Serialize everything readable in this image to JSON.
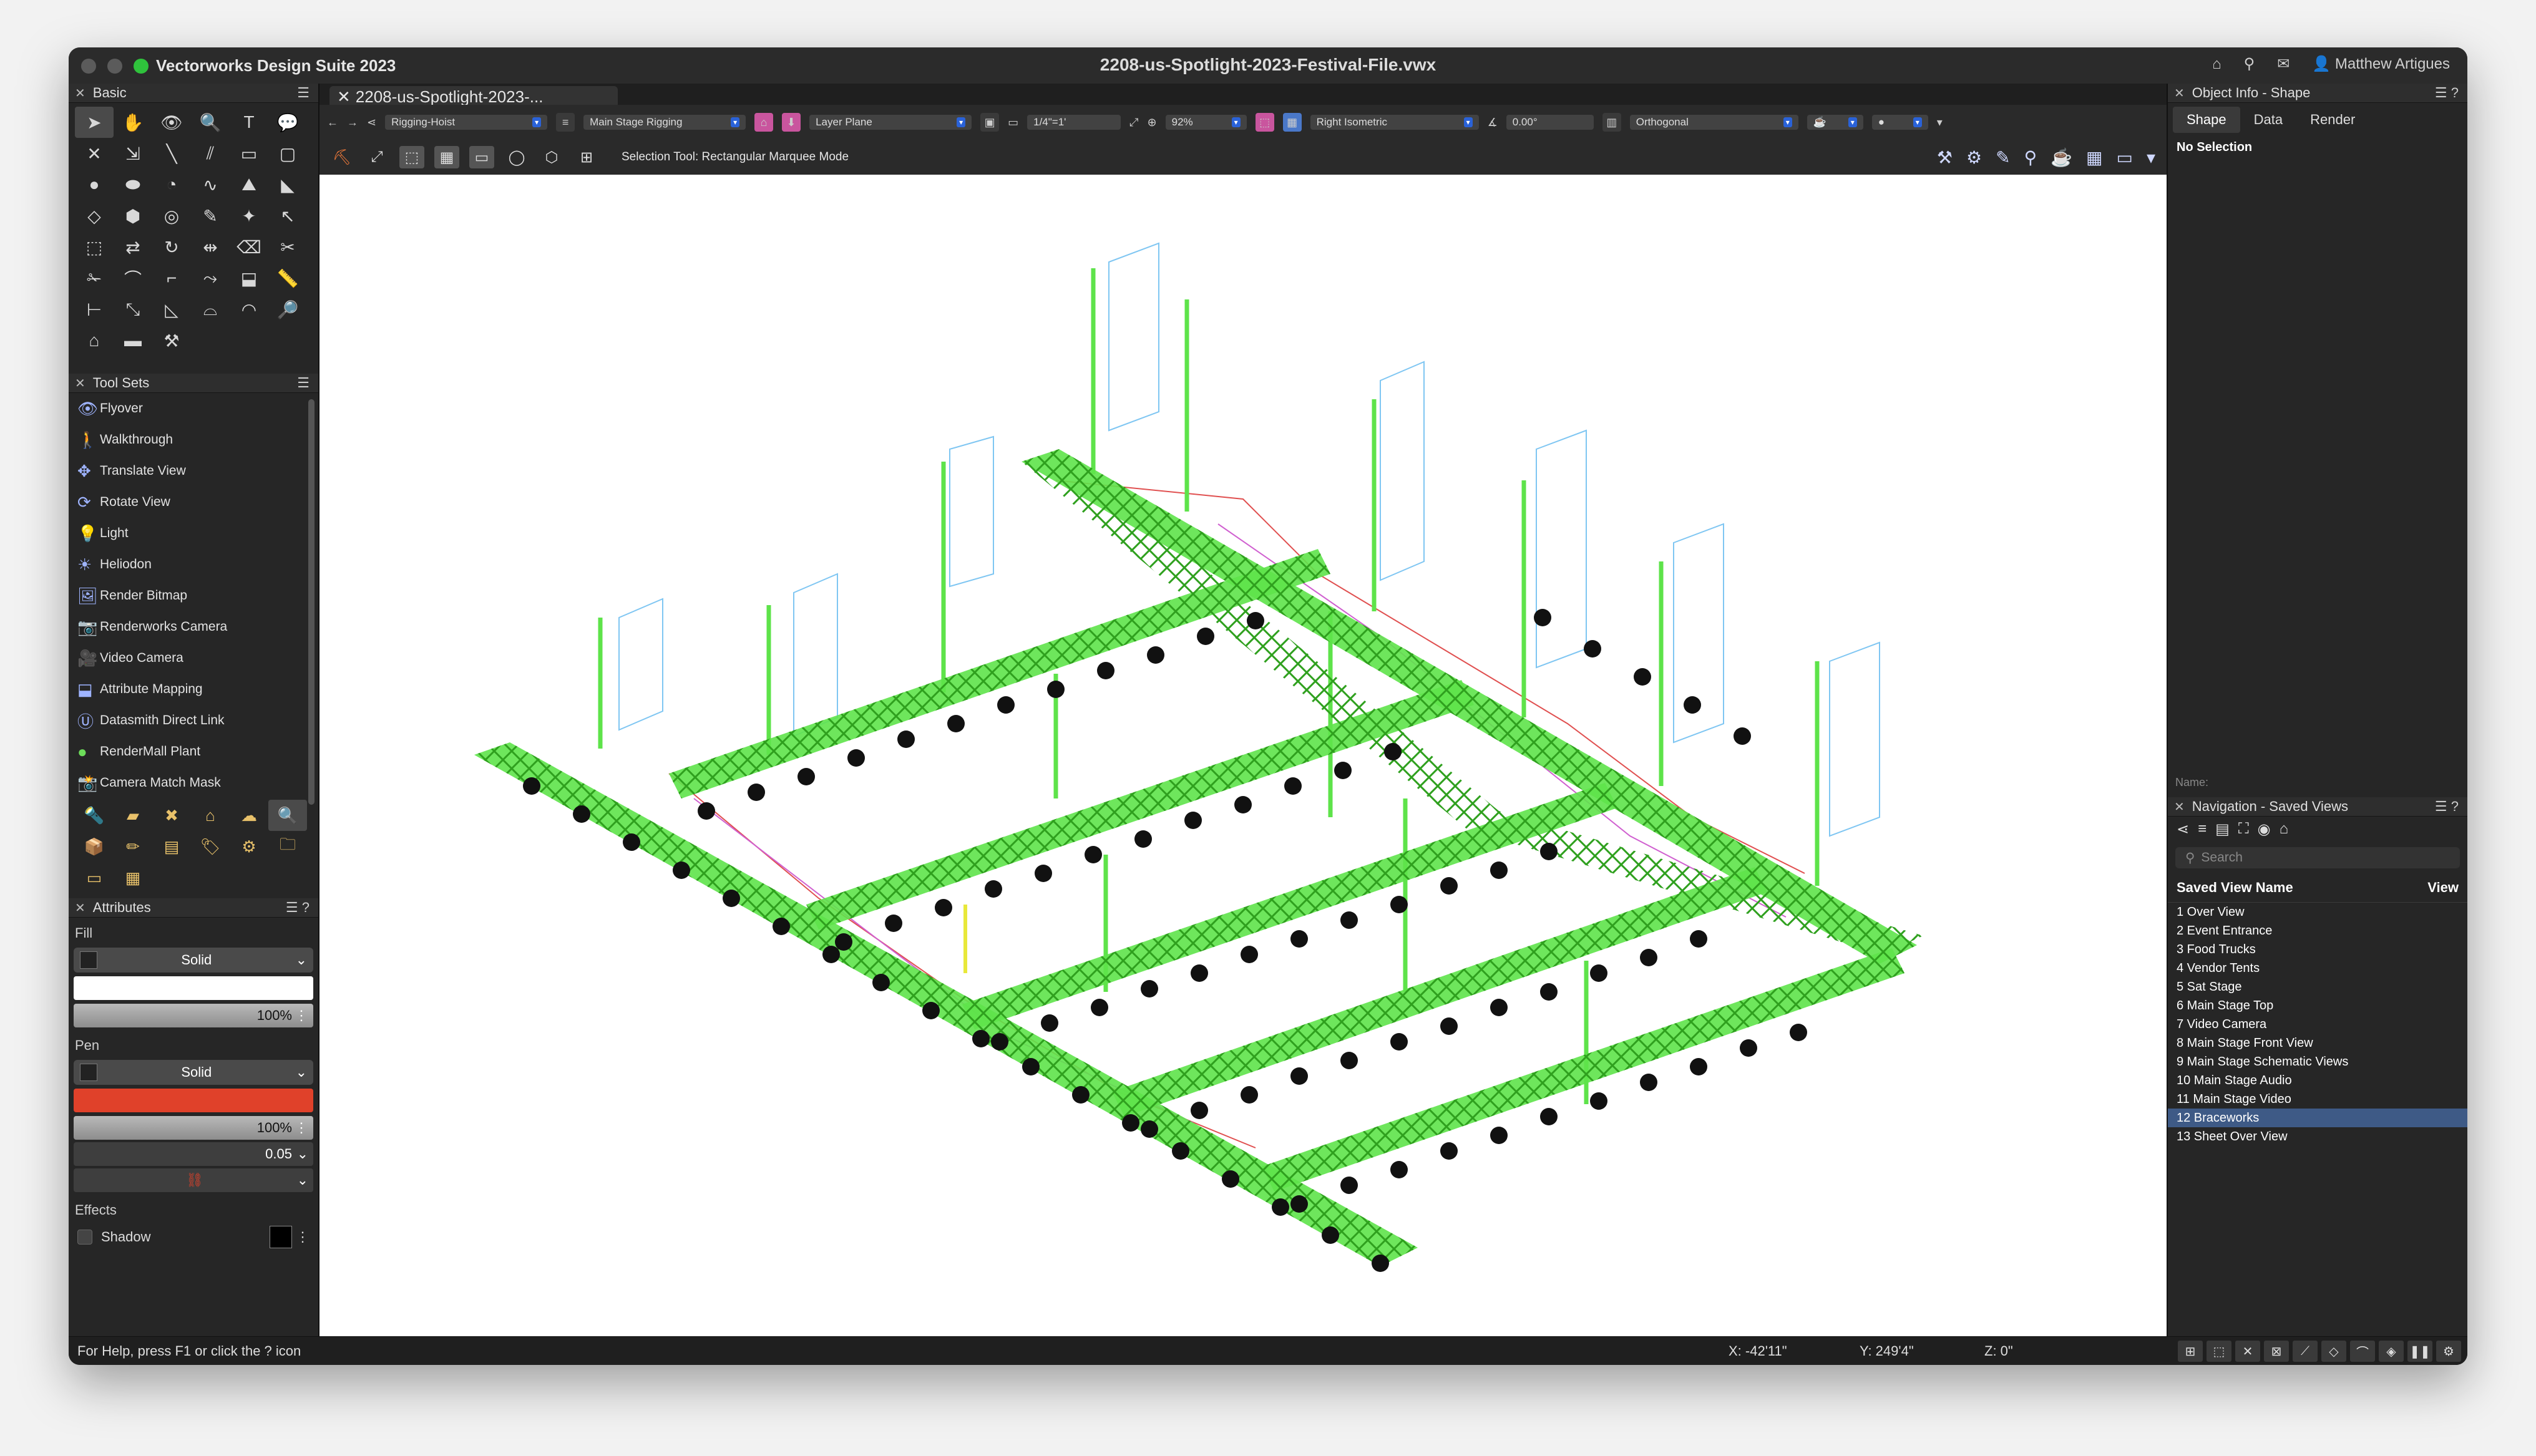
{
  "app": {
    "name": "Vectorworks Design Suite 2023",
    "document": "2208-us-Spotlight-2023-Festival-File.vwx",
    "user": "Matthew Artigues"
  },
  "doc_tab": "2208-us-Spotlight-2023-...",
  "toolbar": {
    "class": "Rigging-Hoist",
    "layer": "Main Stage Rigging",
    "plane": "Layer Plane",
    "scale": "1/4\"=1'",
    "zoom": "92%",
    "view": "Right Isometric",
    "rotation": "0.00°",
    "projection": "Orthogonal",
    "mode_text": "Selection Tool: Rectangular Marquee Mode"
  },
  "palettes": {
    "basic": {
      "title": "Basic"
    },
    "toolsets": {
      "title": "Tool Sets",
      "items": [
        "Flyover",
        "Walkthrough",
        "Translate View",
        "Rotate View",
        "Light",
        "Heliodon",
        "Render Bitmap",
        "Renderworks Camera",
        "Video Camera",
        "Attribute Mapping",
        "Datasmith Direct Link",
        "RenderMall Plant",
        "Camera Match Mask"
      ]
    },
    "attributes": {
      "title": "Attributes",
      "fill_label": "Fill",
      "fill_style": "Solid",
      "fill_color": "#ffffff",
      "fill_opacity": "100%",
      "pen_label": "Pen",
      "pen_style": "Solid",
      "pen_color": "#e0412a",
      "pen_opacity": "100%",
      "pen_weight": "0.05",
      "effects_label": "Effects",
      "shadow_label": "Shadow"
    }
  },
  "object_info": {
    "title": "Object Info - Shape",
    "tabs": [
      "Shape",
      "Data",
      "Render"
    ],
    "selection": "No Selection",
    "name_label": "Name:"
  },
  "navigation": {
    "title": "Navigation - Saved Views",
    "search_placeholder": "Search",
    "col_name": "Saved View Name",
    "col_view": "View",
    "views": [
      "1 Over View",
      "2 Event Entrance",
      "3 Food Trucks",
      "4 Vendor Tents",
      "5 Sat Stage",
      "6 Main Stage Top",
      "7 Video Camera",
      "8 Main Stage Front View",
      "9 Main Stage Schematic Views",
      "10 Main Stage Audio",
      "11 Main Stage Video",
      "12 Braceworks",
      "13 Sheet Over View"
    ],
    "selected_index": 11
  },
  "status": {
    "help": "For Help, press F1 or click the ? icon",
    "x": "X: -42'11\"",
    "y": "Y: 249'4\"",
    "z": "Z: 0\""
  },
  "colors": {
    "truss": "#5ee34a",
    "selection": "#3e5a86"
  }
}
